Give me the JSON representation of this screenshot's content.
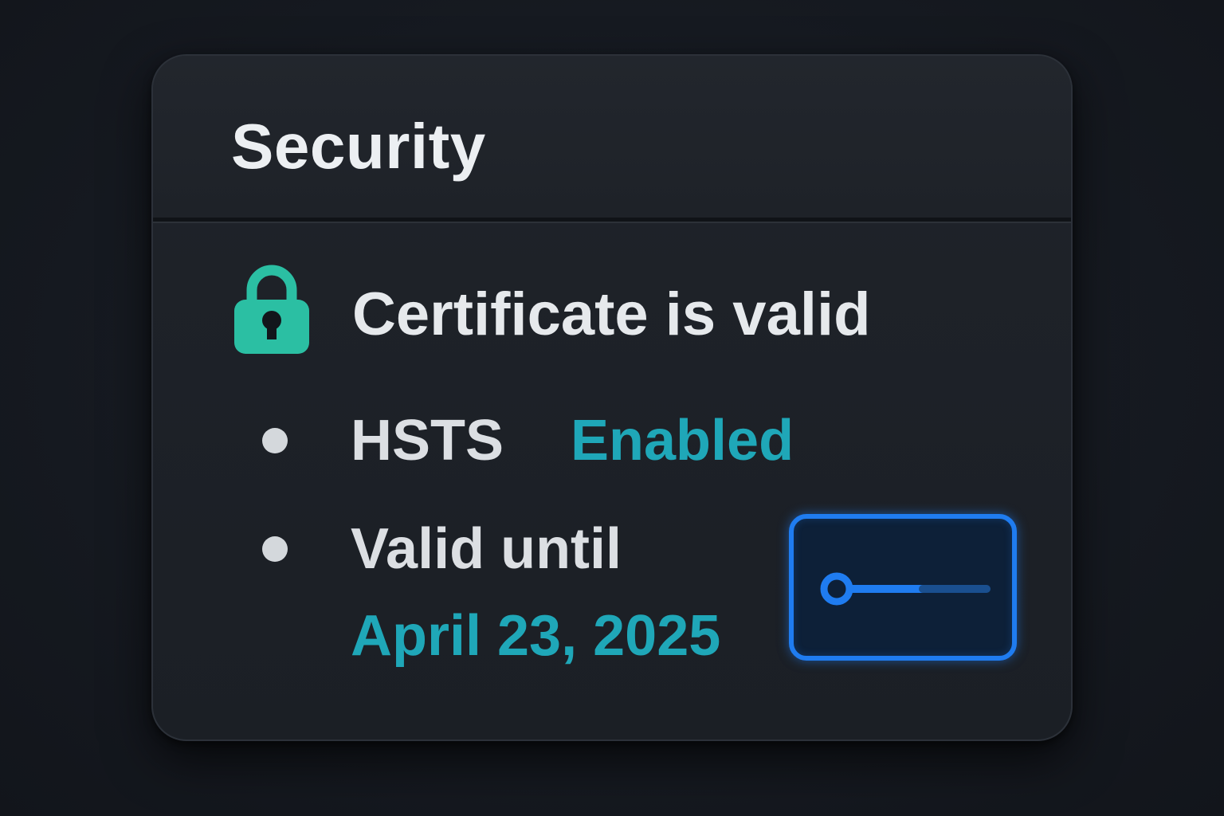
{
  "panel": {
    "title": "Security"
  },
  "certificate": {
    "status_text": "Certificate is valid",
    "icon": "lock-icon",
    "icon_color": "#2bbfa3"
  },
  "details": {
    "hsts": {
      "label": "HSTS",
      "value": "Enabled"
    },
    "validity": {
      "label": "Valid until",
      "date": "April 23, 2025"
    }
  },
  "key_button": {
    "icon": "key-icon",
    "accent_color": "#1f7cf0"
  },
  "colors": {
    "accent_teal": "#1fa7b8",
    "text_primary": "#e6e9ec",
    "card_background": "#1d2127"
  }
}
